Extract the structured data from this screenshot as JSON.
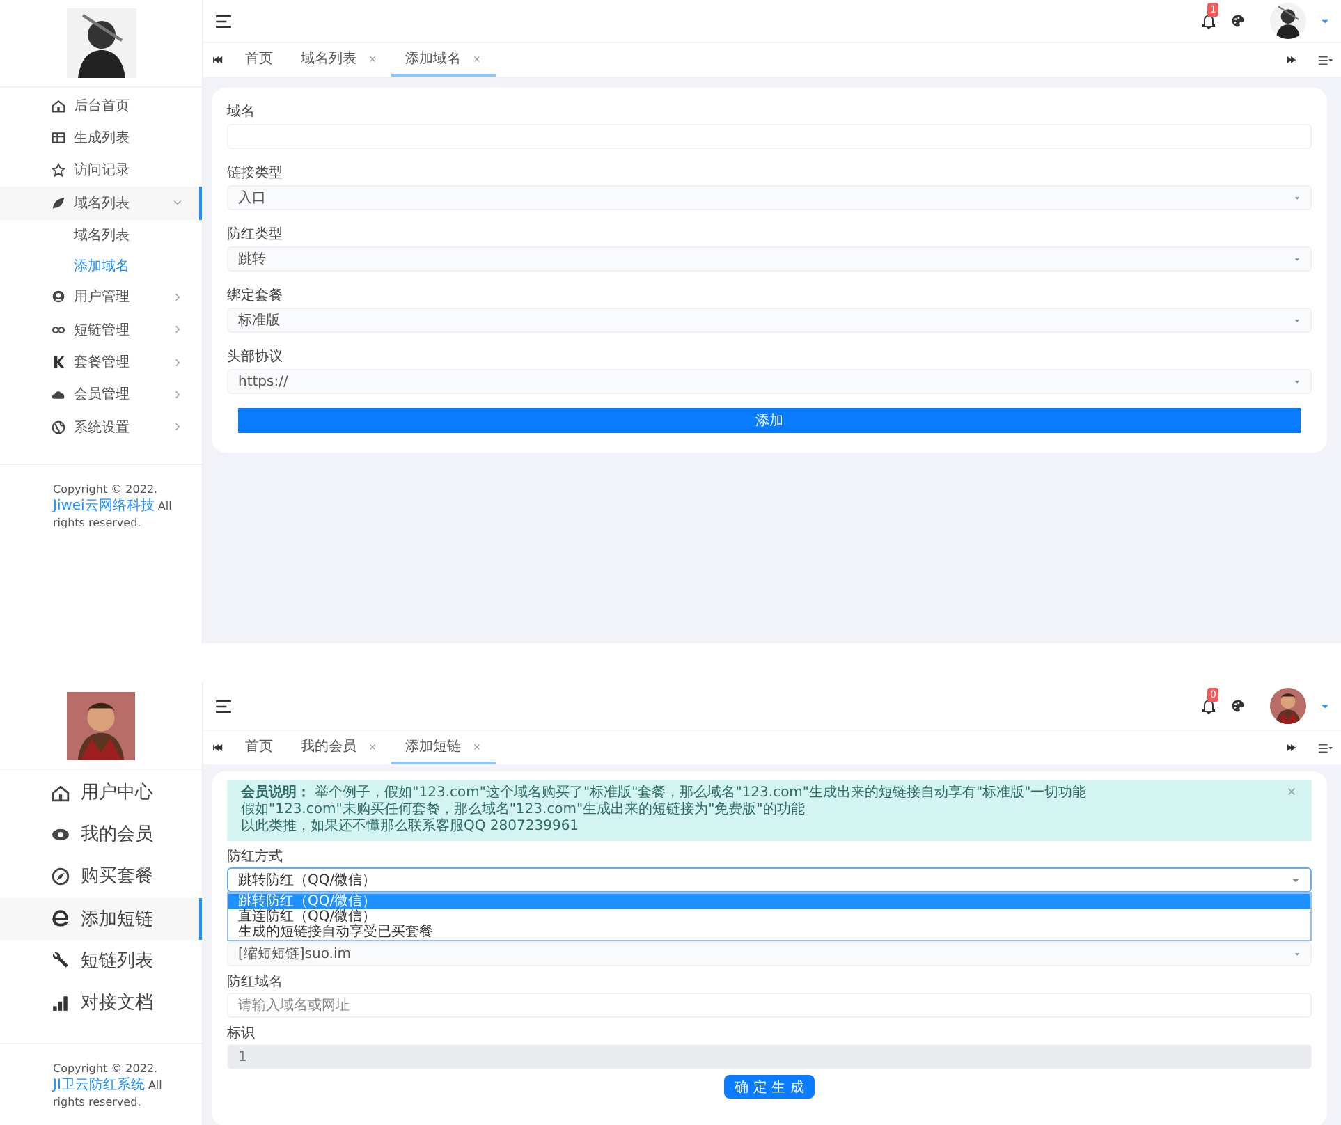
{
  "screens": [
    {
      "header": {
        "notification_count": "1"
      },
      "tabs": [
        {
          "label": "首页",
          "closable": false,
          "selected": false
        },
        {
          "label": "域名列表",
          "closable": true,
          "selected": false
        },
        {
          "label": "添加域名",
          "closable": true,
          "selected": true
        }
      ],
      "sidebar": {
        "items": [
          {
            "label": "后台首页",
            "selected": false
          },
          {
            "label": "生成列表",
            "selected": false
          },
          {
            "label": "访问记录",
            "selected": false
          },
          {
            "label": "域名列表",
            "selected": true,
            "expanded": true,
            "children": [
              {
                "label": "域名列表",
                "selected": false
              },
              {
                "label": "添加域名",
                "selected": true
              }
            ]
          },
          {
            "label": "用户管理",
            "selected": false,
            "expanded": false
          },
          {
            "label": "短链管理",
            "selected": false,
            "expanded": false
          },
          {
            "label": "套餐管理",
            "selected": false,
            "expanded": false
          },
          {
            "label": "会员管理",
            "selected": false,
            "expanded": false
          },
          {
            "label": "系统设置",
            "selected": false,
            "expanded": false
          }
        ]
      },
      "footer": {
        "before": "Copyright © 2022. ",
        "link": "Jiwei云网络科技",
        "after": " All rights reserved."
      },
      "form": {
        "fields": [
          {
            "kind": "input",
            "label": "域名",
            "disabled": false
          },
          {
            "kind": "select",
            "label": "链接类型",
            "value": "入口",
            "disabled": false
          },
          {
            "kind": "select",
            "label": "防红类型",
            "value": "跳转",
            "disabled": false
          },
          {
            "kind": "select",
            "label": "绑定套餐",
            "value": "标准版",
            "disabled": false
          },
          {
            "kind": "select",
            "label": "头部协议",
            "value": "https://",
            "disabled": false
          }
        ],
        "button": {
          "label": "添加",
          "kind": "wide"
        }
      }
    },
    {
      "header": {
        "notification_count": "0"
      },
      "tabs": [
        {
          "label": "首页",
          "closable": false,
          "selected": false
        },
        {
          "label": "我的会员",
          "closable": true,
          "selected": false
        },
        {
          "label": "添加短链",
          "closable": true,
          "selected": true
        }
      ],
      "sidebar": {
        "items": [
          {
            "label": "用户中心",
            "selected": false
          },
          {
            "label": "我的会员",
            "selected": false
          },
          {
            "label": "购买套餐",
            "selected": false
          },
          {
            "label": "添加短链",
            "selected": true
          },
          {
            "label": "短链列表",
            "selected": false
          },
          {
            "label": "对接文档",
            "selected": false
          }
        ]
      },
      "footer": {
        "before": "Copyright © 2022. ",
        "link": "JI卫云防红系统",
        "after": " All rights reserved."
      },
      "form": {
        "alert": {
          "lines": [
            "**会员说明：** 举个例子，假如\"123.com\"这个域名购买了\"标准版\"套餐，那么域名\"123.com\"生成出来的短链接自动享有\"标准版\"一切功能",
            "假如\"123.com\"未购买任何套餐，那么域名\"123.com\"生成出来的短链接为\"免费版\"的功能",
            "以此类推，如果还不懂那么联系客服QQ 2807239961"
          ]
        },
        "fields": [
          {
            "kind": "select",
            "label": "防红方式",
            "value": "跳转防红（QQ/微信）",
            "disabled": false,
            "open": true,
            "options": [
              {
                "label": "跳转防红（QQ/微信）",
                "selected": true
              },
              {
                "label": "直连防红（QQ/微信）",
                "selected": false
              },
              {
                "label": "生成的短链接自动享受已买套餐",
                "selected": false
              }
            ]
          },
          {
            "kind": "select",
            "value": "[缩短短链]suo.im",
            "disabled": false
          },
          {
            "kind": "input",
            "label": "防红域名",
            "placeholder": "请输入域名或网址",
            "disabled": false
          },
          {
            "kind": "input",
            "label": "标识",
            "value": "1",
            "disabled": true
          }
        ],
        "button": {
          "label": "确 定 生 成",
          "kind": "small"
        }
      }
    }
  ]
}
